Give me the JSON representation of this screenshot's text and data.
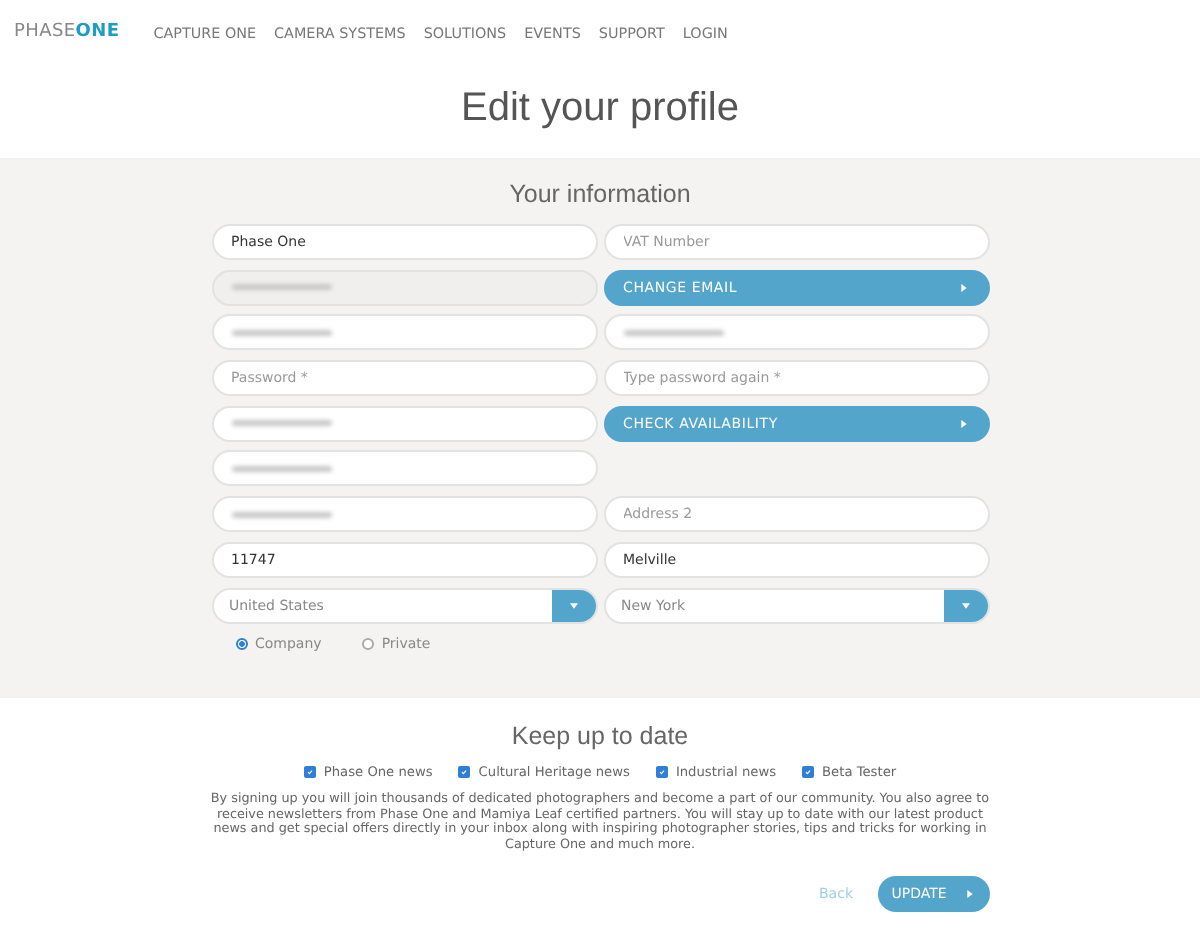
{
  "logo": {
    "light": "PHASE",
    "bold": "ONE"
  },
  "nav": [
    "CAPTURE ONE",
    "CAMERA SYSTEMS",
    "SOLUTIONS",
    "EVENTS",
    "SUPPORT",
    "LOGIN"
  ],
  "page_title": "Edit your profile",
  "info": {
    "title": "Your information",
    "rows": [
      [
        {
          "kind": "field",
          "value": "Phase One"
        },
        {
          "kind": "field",
          "placeholder": "VAT Number"
        }
      ],
      [
        {
          "kind": "redacted",
          "disabled": true
        },
        {
          "kind": "button",
          "label": "CHANGE EMAIL"
        }
      ],
      [
        {
          "kind": "redacted",
          "disabled": false
        },
        {
          "kind": "redacted",
          "disabled": false
        }
      ],
      [
        {
          "kind": "field",
          "placeholder": "Password *"
        },
        {
          "kind": "field",
          "placeholder": "Type password again *"
        }
      ],
      [
        {
          "kind": "redacted",
          "disabled": false
        },
        {
          "kind": "button",
          "label": "CHECK AVAILABILITY"
        }
      ],
      [
        {
          "kind": "redacted",
          "disabled": false
        },
        {
          "kind": "empty"
        }
      ],
      [
        {
          "kind": "redacted",
          "disabled": false
        },
        {
          "kind": "field",
          "placeholder": "Address 2"
        }
      ],
      [
        {
          "kind": "field",
          "value": "11747"
        },
        {
          "kind": "field",
          "value": "Melville"
        }
      ],
      [
        {
          "kind": "select",
          "value": "United States"
        },
        {
          "kind": "select",
          "value": "New York"
        }
      ]
    ],
    "account_type": [
      {
        "label": "Company",
        "selected": true
      },
      {
        "label": "Private",
        "selected": false
      }
    ]
  },
  "newsletter": {
    "title": "Keep up to date",
    "options": [
      {
        "label": "Phase One news",
        "checked": true
      },
      {
        "label": "Cultural Heritage news",
        "checked": true
      },
      {
        "label": "Industrial news",
        "checked": true
      },
      {
        "label": "Beta Tester",
        "checked": true
      }
    ],
    "text": "By signing up you will join thousands of dedicated photographers and become a part of our community. You also agree to receive newsletters from Phase One and Mamiya Leaf certified partners. You will stay up to date with our latest product news and get special offers directly in your inbox along with inspiring photographer stories, tips and tricks for working in Capture One and much more."
  },
  "actions": {
    "back": "Back",
    "submit": "UPDATE"
  }
}
